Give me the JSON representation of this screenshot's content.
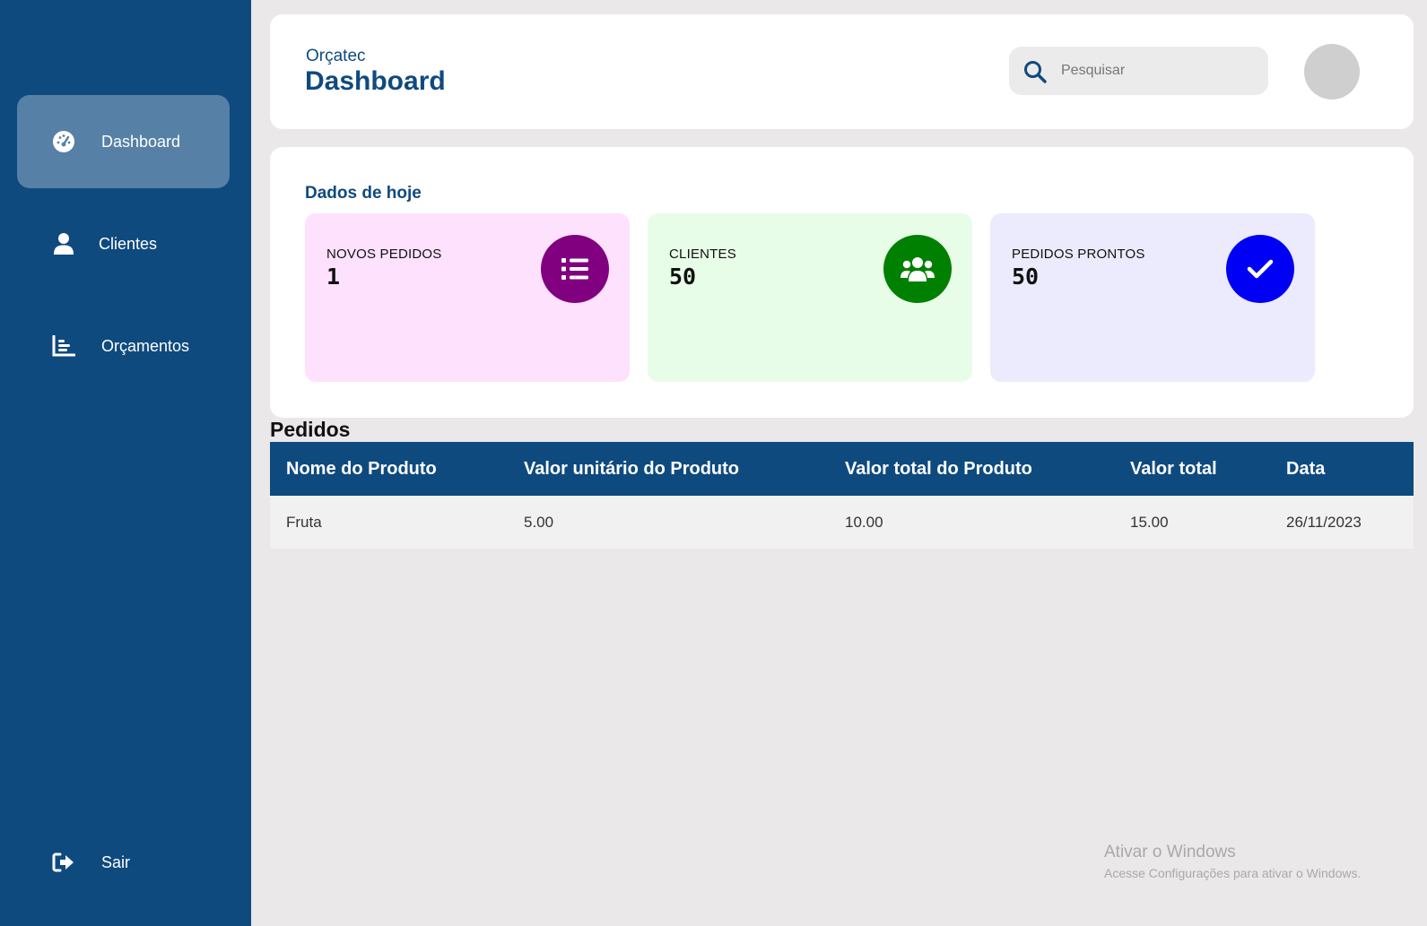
{
  "sidebar": {
    "items": [
      {
        "label": "Dashboard",
        "icon": "gauge-icon",
        "active": true
      },
      {
        "label": "Clientes",
        "icon": "user-icon",
        "active": false
      },
      {
        "label": "Orçamentos",
        "icon": "bar-chart-icon",
        "active": false
      }
    ],
    "logout": {
      "label": "Sair",
      "icon": "sign-out-icon"
    }
  },
  "header": {
    "brand": "Orçatec",
    "title": "Dashboard",
    "search_placeholder": "Pesquisar"
  },
  "stats": {
    "title": "Dados de hoje",
    "cards": [
      {
        "label": "NOVOS PEDIDOS",
        "value": "1",
        "icon": "list-icon",
        "color": "#800080",
        "bg": "#fde1fd"
      },
      {
        "label": "CLIENTES",
        "value": "50",
        "icon": "users-icon",
        "color": "#008000",
        "bg": "#e8fde8"
      },
      {
        "label": "PEDIDOS PRONTOS",
        "value": "50",
        "icon": "check-icon",
        "color": "#0000f5",
        "bg": "#ebebfd"
      }
    ]
  },
  "orders": {
    "title": "Pedidos",
    "columns": [
      "Nome do Produto",
      "Valor unitário do Produto",
      "Valor total do Produto",
      "Valor total",
      "Data"
    ],
    "rows": [
      [
        "Fruta",
        "5.00",
        "10.00",
        "15.00",
        "26/11/2023"
      ]
    ]
  },
  "watermark": {
    "title": "Ativar o Windows",
    "subtitle": "Acesse Configurações para ativar o Windows."
  },
  "colors": {
    "sidebar": "#0f4a7f",
    "active_item": "#5680a6",
    "accent": "#0f4a7f"
  }
}
